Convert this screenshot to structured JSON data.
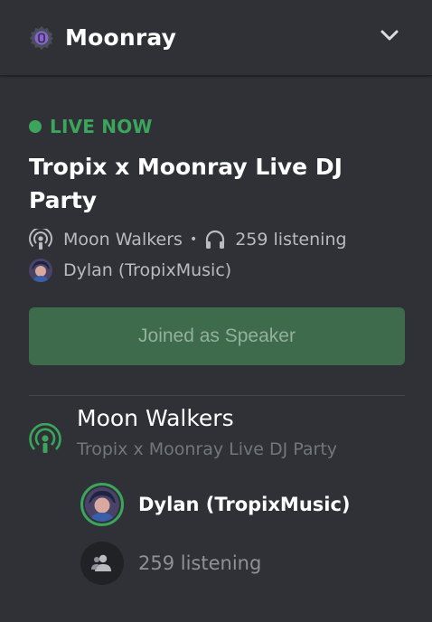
{
  "server": {
    "name": "Moonray",
    "icon": "server-badge-icon",
    "menu_icon": "chevron-down-icon"
  },
  "event": {
    "live_label": "LIVE NOW",
    "title": "Tropix x Moonray Live DJ Party",
    "stage_name": "Moon Walkers",
    "separator": "•",
    "listening": "259 listening",
    "host": "Dylan (TropixMusic)",
    "stage_icon": "stage-channel-icon",
    "listeners_icon": "headphones-icon"
  },
  "join_button": {
    "label": "Joined as Speaker"
  },
  "stage": {
    "name": "Moon Walkers",
    "topic": "Tropix x Moonray Live DJ Party",
    "speaker": "Dylan (TropixMusic)",
    "audience": "259 listening",
    "audience_icon": "people-icon"
  },
  "colors": {
    "background": "#2f3136",
    "live_green": "#3ba55c",
    "button_bg": "#3d6b4b",
    "muted_text": "#b9bbbe"
  }
}
